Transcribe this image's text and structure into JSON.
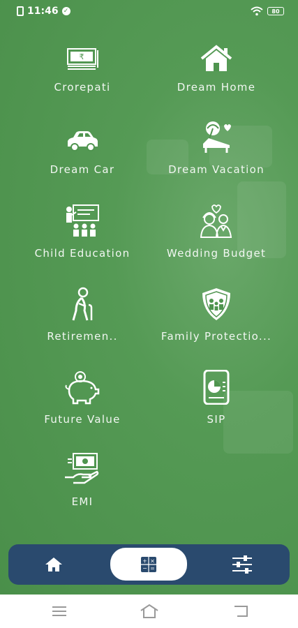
{
  "status": {
    "time": "11:46",
    "battery": "80"
  },
  "calculators": [
    {
      "label": "Crorepati",
      "icon": "money-stack-icon"
    },
    {
      "label": "Dream Home",
      "icon": "house-icon"
    },
    {
      "label": "Dream Car",
      "icon": "car-icon"
    },
    {
      "label": "Dream Vacation",
      "icon": "beach-lounger-icon"
    },
    {
      "label": "Child Education",
      "icon": "classroom-icon"
    },
    {
      "label": "Wedding Budget",
      "icon": "couple-icon"
    },
    {
      "label": "Retiremen..",
      "icon": "elderly-person-icon"
    },
    {
      "label": "Family Protectio...",
      "icon": "family-shield-icon"
    },
    {
      "label": "Future Value",
      "icon": "piggy-bank-icon"
    },
    {
      "label": "SIP",
      "icon": "sip-chart-icon"
    },
    {
      "label": "EMI",
      "icon": "emi-hand-cash-icon"
    }
  ],
  "bottom_nav": [
    "home-icon",
    "calculator-icon",
    "sliders-icon"
  ],
  "colors": {
    "background": "#4f944f",
    "nav": "#2a4a6e",
    "active": "#ffffff"
  }
}
